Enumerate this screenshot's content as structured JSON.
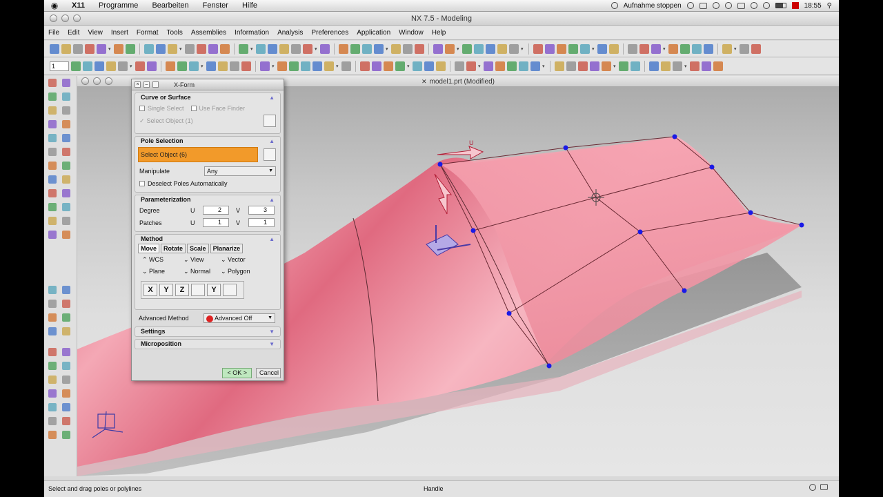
{
  "macbar": {
    "apple": "",
    "items": [
      "X11",
      "Programme",
      "Bearbeiten",
      "Fenster",
      "Hilfe"
    ],
    "recording": "Aufnahme stoppen",
    "clock": "18:55"
  },
  "window": {
    "title": "NX 7.5 - Modeling"
  },
  "appmenu": {
    "items": [
      "File",
      "Edit",
      "View",
      "Insert",
      "Format",
      "Tools",
      "Assemblies",
      "Information",
      "Analysis",
      "Preferences",
      "Application",
      "Window",
      "Help"
    ]
  },
  "toolbar2": {
    "layer_value": "1"
  },
  "viewport": {
    "title": "model1.prt (Modified)"
  },
  "dialog": {
    "title": "X-Form",
    "curve_surface": {
      "header": "Curve or Surface",
      "single_select": "Single Select",
      "use_face_finder": "Use Face Finder",
      "select_object": "Select Object (1)"
    },
    "pole_selection": {
      "header": "Pole Selection",
      "select_object": "Select Object (6)",
      "manipulate_label": "Manipulate",
      "manipulate_value": "Any",
      "deselect_poles": "Deselect Poles Automatically"
    },
    "parameterization": {
      "header": "Parameterization",
      "degree_label": "Degree",
      "patches_label": "Patches",
      "u": "U",
      "v": "V",
      "degree_u": "2",
      "degree_v": "3",
      "patches_u": "1",
      "patches_v": "1"
    },
    "method": {
      "header": "Method",
      "tabs": [
        "Move",
        "Rotate",
        "Scale",
        "Planarize"
      ],
      "options": [
        "WCS",
        "View",
        "Vector",
        "Plane",
        "Normal",
        "Polygon"
      ],
      "axis_buttons": [
        "X",
        "Y",
        "Z",
        "",
        "Y",
        ""
      ]
    },
    "advanced": {
      "label": "Advanced Method",
      "value": "Advanced Off"
    },
    "settings": "Settings",
    "microposition": "Microposition",
    "ok": "< OK >",
    "cancel": "Cancel"
  },
  "scene": {
    "handle_label": "U"
  },
  "status": {
    "prompt": "Select and drag poles or polylines",
    "center": "Handle"
  },
  "colors": {
    "surface": "#e8758a",
    "surface_light": "#f6b9c4",
    "pole": "#1a1ae6",
    "selection": "#f29a2a"
  }
}
